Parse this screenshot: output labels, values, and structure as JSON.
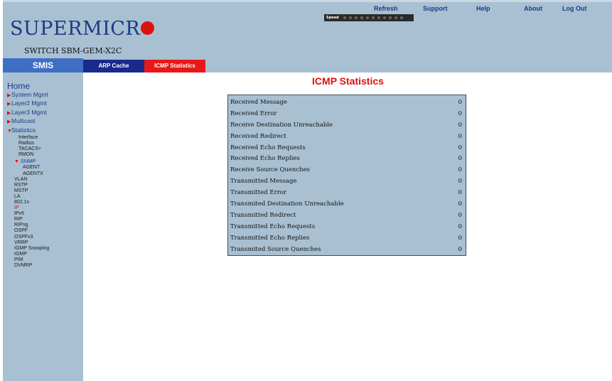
{
  "brand": {
    "name": "SUPERMICR",
    "switch_name": "SWITCH SBM-GEM-X2C"
  },
  "speed": {
    "label": "Speed"
  },
  "topnav": {
    "refresh": "Refresh",
    "support": "Support",
    "help": "Help",
    "about": "About",
    "logout": "Log Out"
  },
  "smis": "SMIS",
  "tabs": {
    "arp": "ARP Cache",
    "icmp": "ICMP Statistics"
  },
  "sidebar": {
    "home": "Home",
    "items": {
      "system": "System Mgmt",
      "layer2": "Layer2 Mgmt",
      "layer3": "Layer3 Mgmt",
      "multicast": "Multicast",
      "statistics": "Statistics"
    },
    "stats_sub": [
      "Interface",
      "Radius",
      "TACACS+",
      "RMON"
    ],
    "snmp": "SNMP",
    "snmp_sub": [
      "AGENT",
      "AGENTX"
    ],
    "stats_sub2": [
      "VLAN",
      "RSTP",
      "MSTP",
      "LA",
      "802.1x",
      "IP",
      "IPv6",
      "RIP",
      "RIPng",
      "OSPF",
      "OSPFv3",
      "VRRP",
      "IGMP Snooping",
      "IGMP",
      "PIM",
      "DVMRP"
    ]
  },
  "page_title": "ICMP Statistics",
  "stats": [
    {
      "label": "Received Message",
      "value": "0"
    },
    {
      "label": "Received Error",
      "value": "0"
    },
    {
      "label": "Receive Destination Unreachable",
      "value": "0"
    },
    {
      "label": "Received Redirect",
      "value": "0"
    },
    {
      "label": "Received Echo Requests",
      "value": "0"
    },
    {
      "label": "Received Echo Replies",
      "value": "0"
    },
    {
      "label": "Receive Source Quenches",
      "value": "0"
    },
    {
      "label": "Transmitted Message",
      "value": "0"
    },
    {
      "label": "Transmitted Error",
      "value": "0"
    },
    {
      "label": "Transmited Destination Unreachable",
      "value": "0"
    },
    {
      "label": "Transmitted Redirect",
      "value": "0"
    },
    {
      "label": "Transmitted Echo Requests",
      "value": "0"
    },
    {
      "label": "Transmitted Echo Replies",
      "value": "0"
    },
    {
      "label": "Transmited Source Quenches",
      "value": "0"
    }
  ],
  "colors": {
    "accent_red": "#e01010",
    "header_bg": "#a8c0d2",
    "smis_blue": "#3e6fc5",
    "tab_navy": "#1a2a8c"
  }
}
